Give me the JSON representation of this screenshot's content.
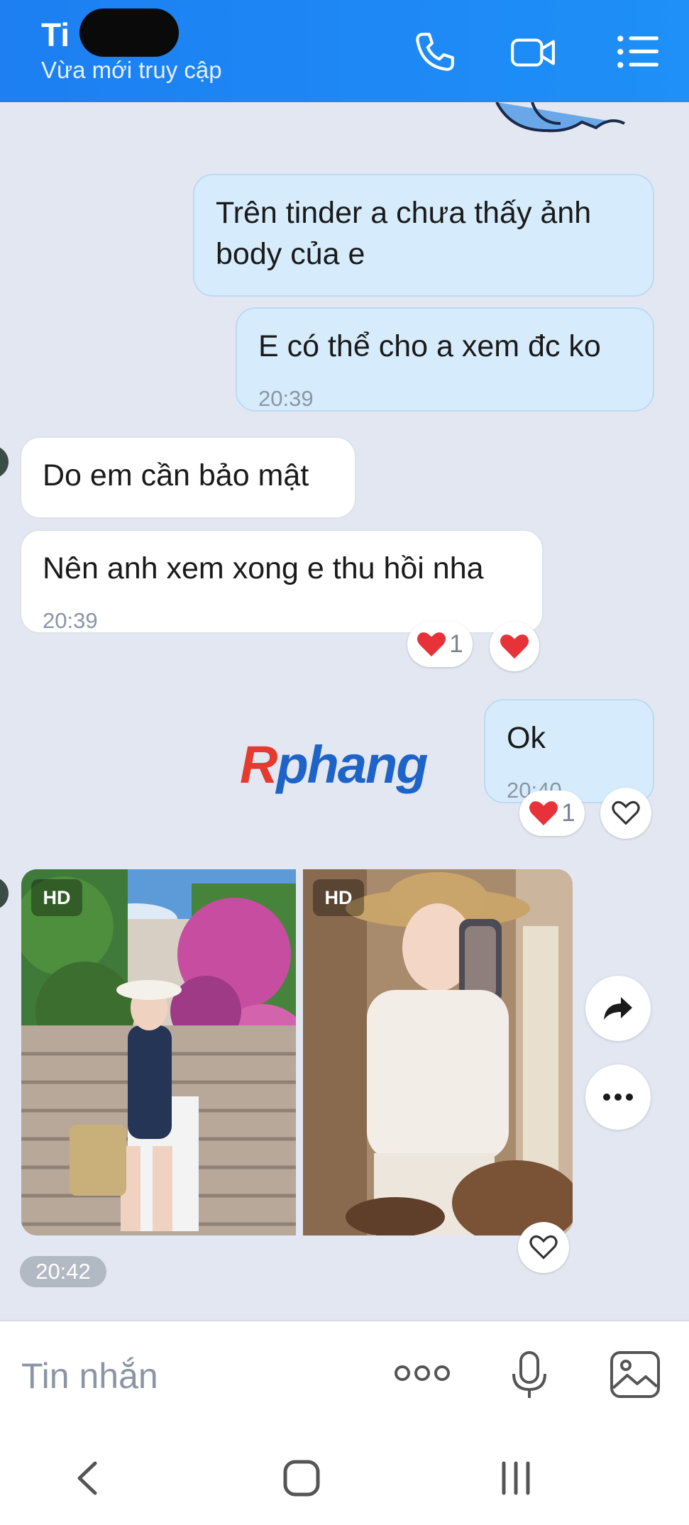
{
  "header": {
    "contact_name": "Ti",
    "status": "Vừa mới truy cập",
    "icons": [
      "phone-icon",
      "video-call-icon",
      "menu-icon"
    ]
  },
  "messages": [
    {
      "direction": "out",
      "text": "Trên tinder a chưa thấy ảnh body của e",
      "time": ""
    },
    {
      "direction": "out",
      "text": "E có thể cho a xem đc ko",
      "time": "20:39"
    },
    {
      "direction": "in",
      "text": "Do em cần bảo mật",
      "time": ""
    },
    {
      "direction": "in",
      "text": "Nên anh xem xong e thu hồi nha",
      "time": "20:39"
    },
    {
      "direction": "out",
      "text": "Ok",
      "time": "20:40"
    }
  ],
  "reactions": {
    "msg4_count": "1",
    "msg5_count": "1"
  },
  "watermark": {
    "r": "R",
    "rest": "phang"
  },
  "photos": {
    "badge_1": "HD",
    "badge_2": "HD",
    "time": "20:42"
  },
  "input": {
    "placeholder": "Tin nhắn"
  },
  "colors": {
    "header": "#1d7ff2",
    "background": "#e2e7f1",
    "out_bubble": "#d6ecfc",
    "in_bubble": "#ffffff",
    "heart": "#e8323a"
  }
}
